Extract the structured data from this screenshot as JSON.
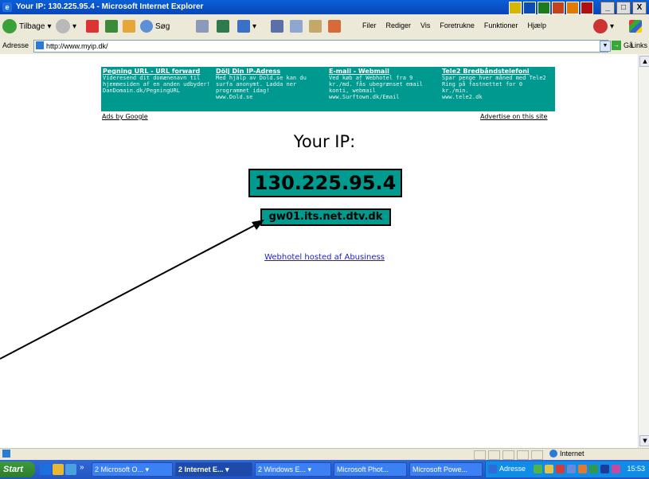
{
  "window": {
    "title": "Your IP: 130.225.95.4 - Microsoft Internet Explorer",
    "buttons": [
      "_",
      "□",
      "X"
    ]
  },
  "toolbar": {
    "back_label": "Tilbage",
    "search_label": "Søg",
    "menu": [
      "Filer",
      "Rediger",
      "Vis",
      "Foretrukne",
      "Funktioner",
      "Hjælp"
    ]
  },
  "address": {
    "label": "Adresse",
    "url": "http://www.myip.dk/",
    "go_label": "Gå",
    "links_label": "Links"
  },
  "ads": [
    {
      "title": "Pegning URL - URL forward",
      "body": "Videresend dit domænenavn til hjemmesiden af en anden udbyder!",
      "url": "DanDomain.dk/PegningURL"
    },
    {
      "title": "Dölj Din IP-Adress",
      "body": "Med hjälp av Dold.se kan du surfa anonymt. Ladda ner programmet idag!",
      "url": "www.Dold.se"
    },
    {
      "title": "E-mail - Webmail",
      "body": "Ved køb af Webhotel fra 9 kr./md. fås ubegrænset email konti, webmail",
      "url": "www.Surftown.dk/Email"
    },
    {
      "title": "Tele2 Bredbåndstelefoni",
      "body": "Spar penge hver måned med Tele2 Ring på fastnettet for 0 kr./min.",
      "url": "www.tele2.dk"
    }
  ],
  "ads_by": "Ads by Google",
  "advertise": "Advertise on this site",
  "heading": "Your IP:",
  "ip": "130.225.95.4",
  "hostname": "gw01.its.net.dtv.dk",
  "webhotel_link": "Webhotel hosted af Abusiness",
  "status": {
    "zone": "Internet"
  },
  "taskbar": {
    "start": "Start",
    "chevron": "»",
    "tasks": [
      {
        "label": "2 Microsoft O... ▾",
        "active": false
      },
      {
        "label": "2 Internet E... ▾",
        "active": true
      },
      {
        "label": "2 Windows E... ▾",
        "active": false
      },
      {
        "label": "Microsoft Phot...",
        "active": false
      },
      {
        "label": "Microsoft Powe...",
        "active": false
      }
    ],
    "address_label": "Adresse",
    "clock": "15:53"
  },
  "colors": {
    "teal": "#009a8e",
    "xp_blue": "#2356c3",
    "link_blue": "#2020cc"
  }
}
